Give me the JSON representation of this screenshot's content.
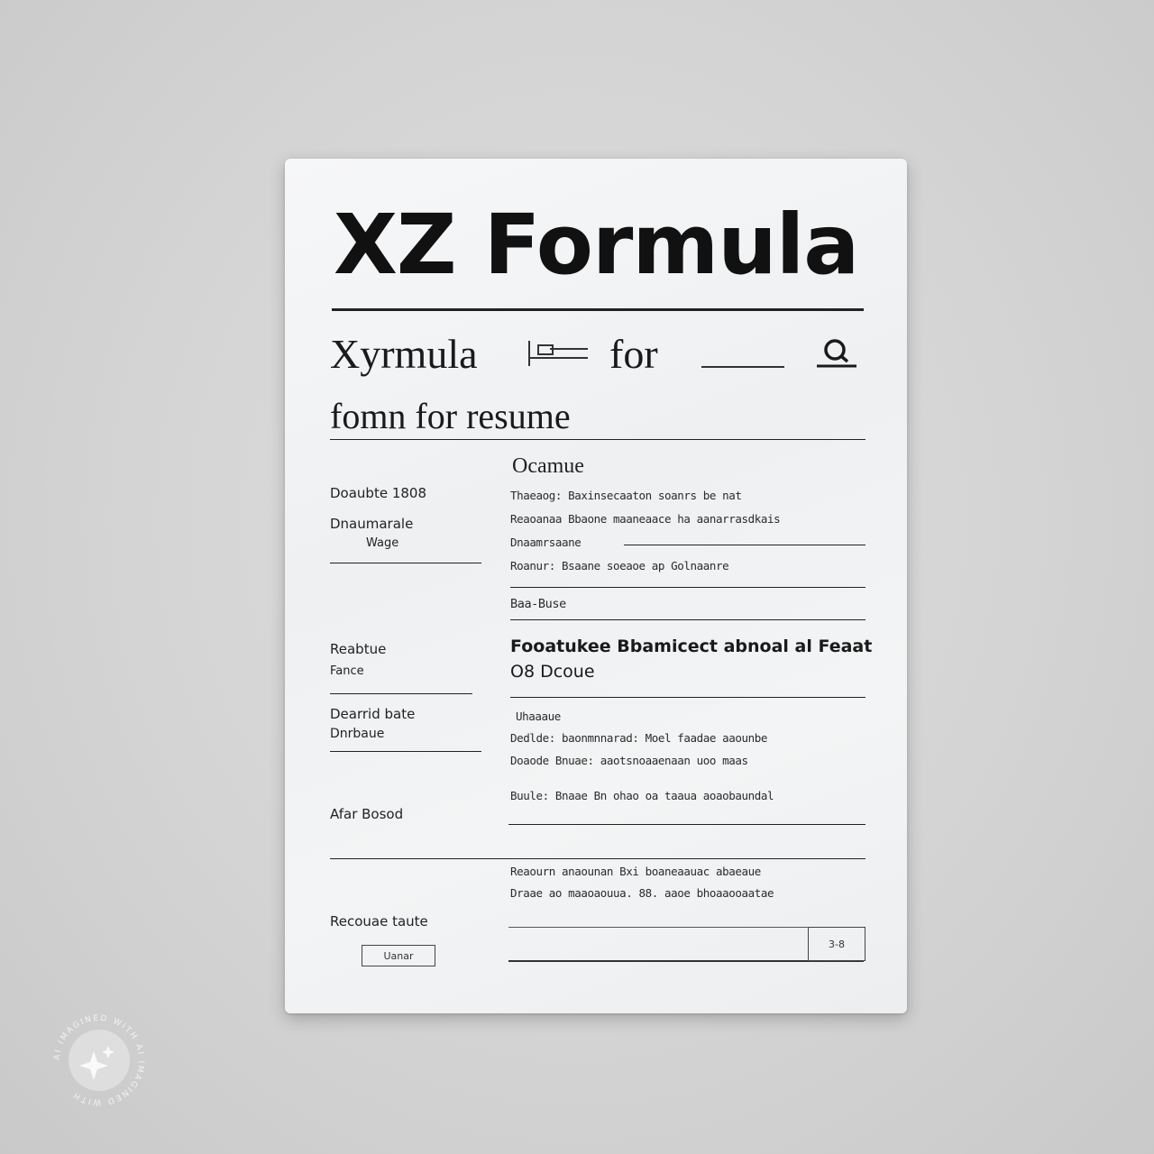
{
  "document": {
    "title": "XZ Formula",
    "subtitle_line1_word1": "Xyrmula",
    "subtitle_line1_word2": "for",
    "subtitle_line2": "fomn for resume",
    "section_heading": "Ocamue",
    "left_column": {
      "label1": "Doaubte 1808",
      "label2": "Dnaumarale",
      "label2b": "Wage",
      "label3": "Reabtue",
      "label3b": "Fance",
      "label4": "Dearrid bate",
      "label4b": "Dnrbaue",
      "label5": "Afar Bosod",
      "label6": "Recouae taute",
      "button_label": "Uanar"
    },
    "right_column": {
      "line1": "Thaeaog: Baxinsecaaton soanrs be nat",
      "line2": "Reaoanaa Bbaone maaneaace ha aanarrasdkais",
      "line3": "Dnaamrsaane",
      "line4": "Roanur: Bsaane soeaoe ap Golnaanre",
      "line5": "Baa-Buse",
      "heading2": "Fooatukee Bbamicect abnoal al Feaat",
      "heading2b": "O8 Dcoue",
      "line6": "Uhaaaue",
      "line7": "Dedlde: baonmnnarad: Moel faadae aaounbe",
      "line8": "Doaode Bnuae: aaotsnoaaenaan uoo maas",
      "line9": "Buule: Bnaae Bn ohao oa taaua aoaobaundal",
      "line10": "Reaourn anaounan Bxi boaneaauac abaeaue",
      "line11": "Draae ao maaoaouua. 88. aaoe bhoaaooaatae",
      "input_button_label": "3-8"
    }
  },
  "watermark": {
    "text": "AI IMAGINED WITH AI IMAGINED WITH",
    "icon": "sparkle-icon"
  }
}
